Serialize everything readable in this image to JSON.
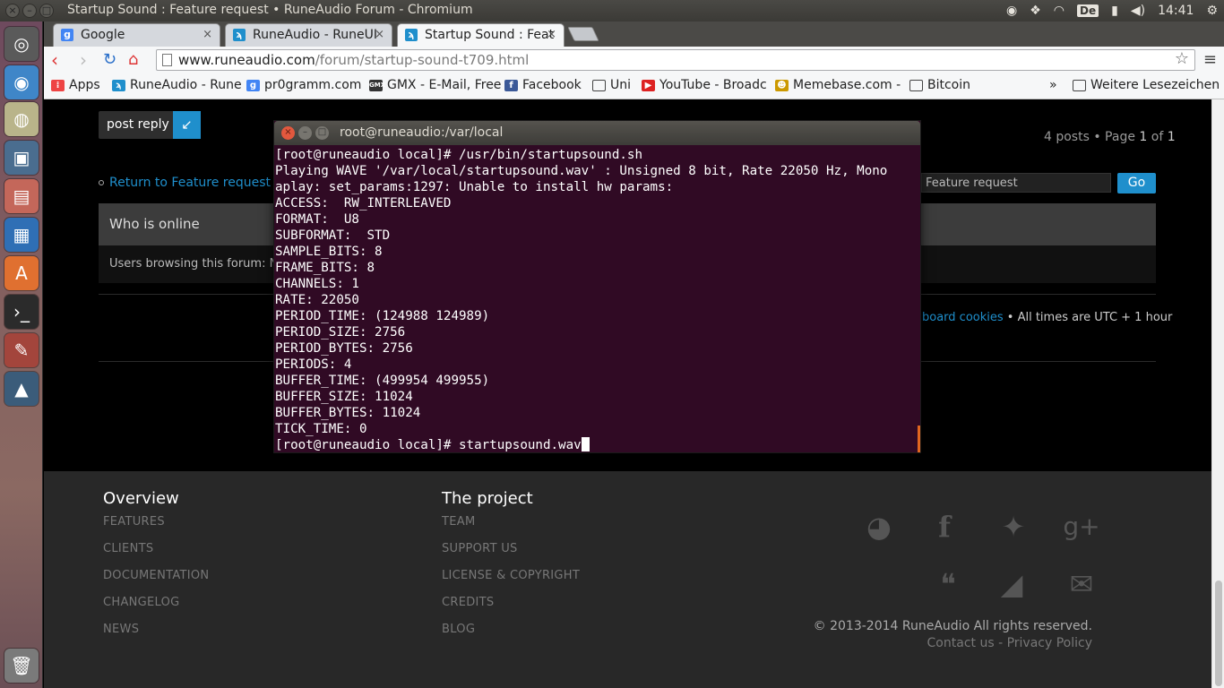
{
  "window": {
    "title": "Startup Sound : Feature request • RuneAudio Forum - Chromium"
  },
  "tray": {
    "keyboard": "De",
    "clock": "14:41"
  },
  "tabs": [
    {
      "label": "Google"
    },
    {
      "label": "RuneAudio - RuneUI"
    },
    {
      "label": "Startup Sound : Feat"
    }
  ],
  "toolbar": {
    "url_host": "www.runeaudio.com",
    "url_path": "/forum/startup-sound-t709.html"
  },
  "bookmarks": {
    "items": [
      "Apps",
      "RuneAudio - Rune",
      "pr0gramm.com",
      "GMX - E-Mail, Free",
      "Facebook",
      "Uni",
      "YouTube - Broadc",
      "Memebase.com -",
      "Bitcoin"
    ],
    "overflow": "»",
    "other": "Weitere Lesezeichen"
  },
  "forum": {
    "post_reply": "post reply",
    "page_info_prefix": "4 posts • Page ",
    "page_current": "1",
    "page_of": " of ",
    "page_total": "1",
    "return_link": "Return to Feature request",
    "jump_value": "Feature request",
    "go": "Go",
    "who_online": "Who is online",
    "users_browsing": "Users browsing this forum: No",
    "cookies_link": "board cookies",
    "timezone": " • All times are UTC + 1 hour"
  },
  "footer": {
    "overview_title": "Overview",
    "overview_items": [
      "FEATURES",
      "CLIENTS",
      "DOCUMENTATION",
      "CHANGELOG",
      "NEWS"
    ],
    "project_title": "The project",
    "project_items": [
      "TEAM",
      "SUPPORT US",
      "LICENSE & COPYRIGHT",
      "CREDITS",
      "BLOG"
    ],
    "copyright": "© 2013-2014 RuneAudio All rights reserved.",
    "contact": "Contact us",
    "sep": " - ",
    "privacy": "Privacy Policy"
  },
  "terminal": {
    "title": "root@runeaudio:/var/local",
    "output": "[root@runeaudio local]# /usr/bin/startupsound.sh\nPlaying WAVE '/var/local/startupsound.wav' : Unsigned 8 bit, Rate 22050 Hz, Mono\naplay: set_params:1297: Unable to install hw params:\nACCESS:  RW_INTERLEAVED\nFORMAT:  U8\nSUBFORMAT:  STD\nSAMPLE_BITS: 8\nFRAME_BITS: 8\nCHANNELS: 1\nRATE: 22050\nPERIOD_TIME: (124988 124989)\nPERIOD_SIZE: 2756\nPERIOD_BYTES: 2756\nPERIODS: 4\nBUFFER_TIME: (499954 499955)\nBUFFER_SIZE: 11024\nBUFFER_BYTES: 11024\nTICK_TIME: 0\n[root@runeaudio local]# startupsound.wav"
  }
}
